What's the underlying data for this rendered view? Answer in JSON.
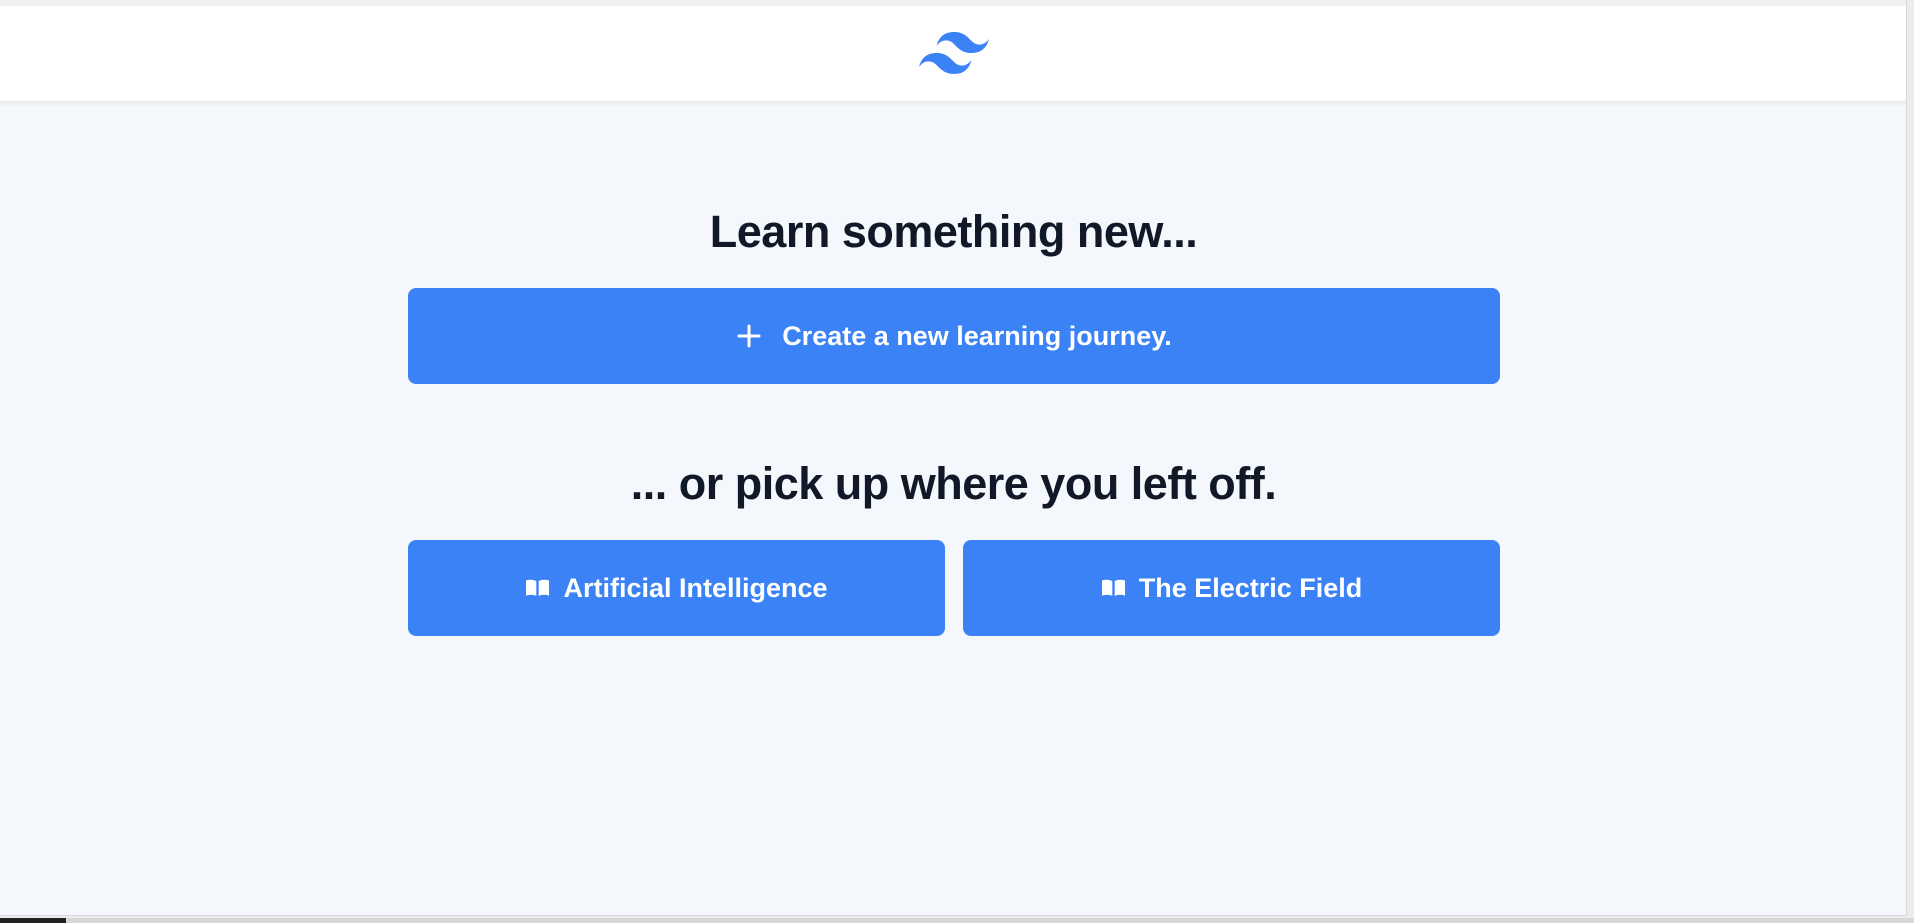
{
  "header": {
    "logo_icon": "wave-logo-icon",
    "logo_color": "#3b82f6"
  },
  "main": {
    "heading_new": "Learn something new...",
    "create_button": {
      "icon": "plus-icon",
      "label": "Create a new learning journey."
    },
    "heading_resume": "... or pick up where you left off.",
    "journeys": [
      {
        "icon": "book-icon",
        "label": "Artificial Intelligence"
      },
      {
        "icon": "book-icon",
        "label": "The Electric Field"
      }
    ]
  },
  "colors": {
    "accent": "#3b82f6",
    "background": "#f4f7fb",
    "heading": "#111827",
    "header_bg": "#ffffff"
  }
}
